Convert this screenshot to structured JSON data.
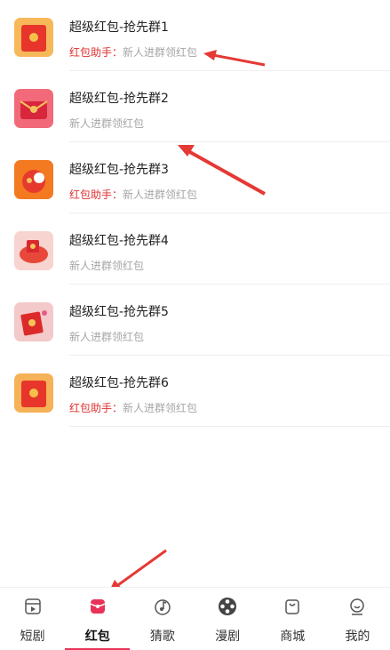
{
  "groups": [
    {
      "title": "超级红包-抢先群1",
      "prefix": "红包助手：",
      "message": "新人进群领红包"
    },
    {
      "title": "超级红包-抢先群2",
      "prefix": "",
      "message": "新人进群领红包"
    },
    {
      "title": "超级红包-抢先群3",
      "prefix": "红包助手：",
      "message": "新人进群领红包"
    },
    {
      "title": "超级红包-抢先群4",
      "prefix": "",
      "message": "新人进群领红包"
    },
    {
      "title": "超级红包-抢先群5",
      "prefix": "",
      "message": "新人进群领红包"
    },
    {
      "title": "超级红包-抢先群6",
      "prefix": "红包助手：",
      "message": "新人进群领红包"
    }
  ],
  "tabs": [
    {
      "label": "短剧",
      "icon": "film-frame-icon"
    },
    {
      "label": "红包",
      "icon": "red-packet-icon"
    },
    {
      "label": "猜歌",
      "icon": "music-note-icon"
    },
    {
      "label": "漫剧",
      "icon": "film-reel-icon"
    },
    {
      "label": "商城",
      "icon": "shopping-bag-icon"
    },
    {
      "label": "我的",
      "icon": "smile-face-icon"
    }
  ],
  "colors": {
    "accent": "#e83358",
    "prefix": "#e0312f",
    "arrow": "#e53935"
  }
}
